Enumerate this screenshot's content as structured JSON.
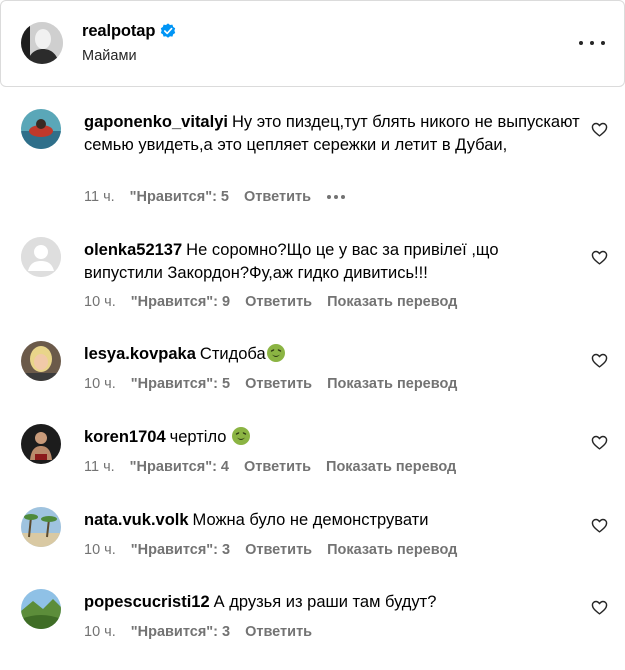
{
  "post": {
    "username": "realpotap",
    "location": "Майами",
    "verified": true
  },
  "comments": [
    {
      "username": "gaponenko_vitalyi",
      "text": "Ну это пиздец,тут блять никого не выпускают семью увидеть,а это цепляет сережки и летит в Дубаи,",
      "time": "11 ч.",
      "likes": "\"Нравится\": 5",
      "reply": "Ответить",
      "translate": ""
    },
    {
      "username": "olenka52137",
      "text": "Не соромно?Що це у вас за привілеї ,що випустили Закордон?Фу,аж гидко дивитись!!!",
      "time": "10 ч.",
      "likes": "\"Нравится\": 9",
      "reply": "Ответить",
      "translate": "Показать перевод"
    },
    {
      "username": "lesya.kovpaka",
      "text": "Стидоба",
      "time": "10 ч.",
      "likes": "\"Нравится\": 5",
      "reply": "Ответить",
      "translate": "Показать перевод"
    },
    {
      "username": "koren1704",
      "text": "чертіло ",
      "time": "11 ч.",
      "likes": "\"Нравится\": 4",
      "reply": "Ответить",
      "translate": "Показать перевод"
    },
    {
      "username": "nata.vuk.volk",
      "text": "Можна було не демонструвати",
      "time": "10 ч.",
      "likes": "\"Нравится\": 3",
      "reply": "Ответить",
      "translate": "Показать перевод"
    },
    {
      "username": "popescucristi12",
      "text": "А друзья из раши там будут?",
      "time": "10 ч.",
      "likes": "\"Нравится\": 3",
      "reply": "Ответить",
      "translate": ""
    }
  ],
  "icons": {
    "verified": "verified-badge-icon",
    "more": "more-options-icon",
    "like": "heart-icon",
    "emoji": "nauseated-face-emoji"
  },
  "colors": {
    "verified_blue": "#0095f6",
    "muted_text": "#737373",
    "emoji_green": "#8bb443"
  }
}
